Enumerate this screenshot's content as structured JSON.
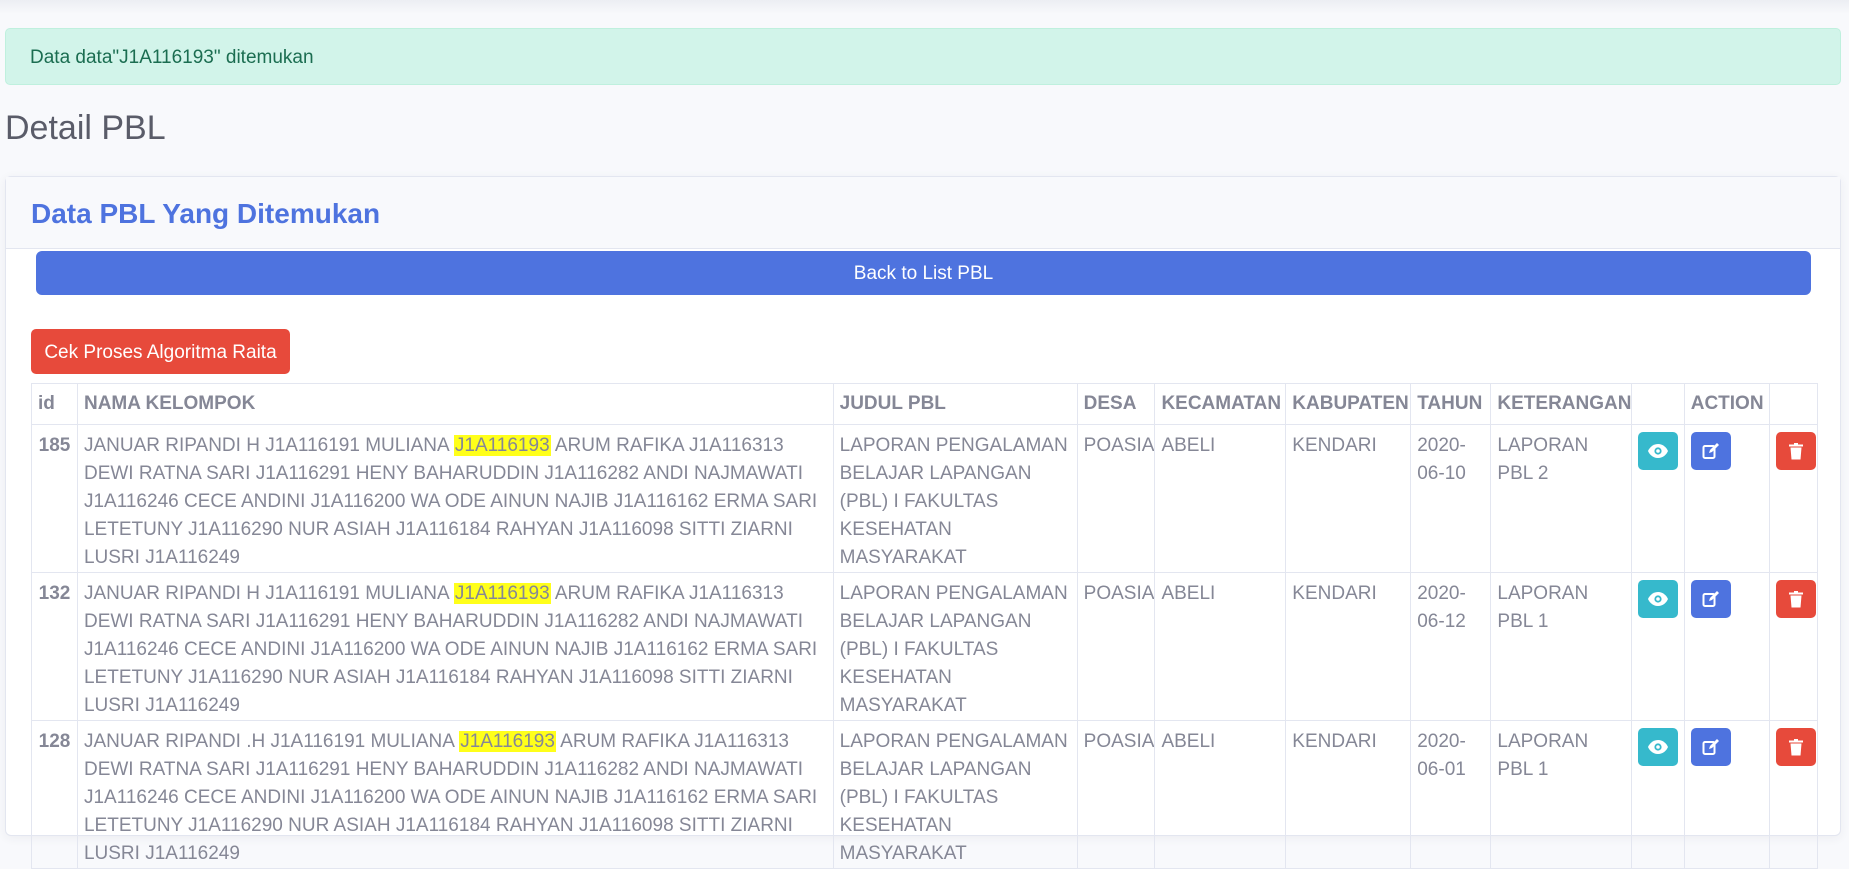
{
  "alert": {
    "message": "Data data\"J1A116193\" ditemukan"
  },
  "page": {
    "title": "Detail PBL"
  },
  "card": {
    "title": "Data PBL Yang Ditemukan",
    "back_label": "Back to List PBL",
    "cek_label": "Cek Proses Algoritma Raita"
  },
  "search": {
    "highlight": "J1A116193"
  },
  "table": {
    "headers": {
      "id": "id",
      "nama": "NAMA KELOMPOK",
      "judul": "JUDUL PBL",
      "desa": "DESA",
      "kecamatan": "KECAMATAN",
      "kabupaten": "KABUPATEN",
      "tahun": "TAHUN",
      "keterangan": "KETERANGAN",
      "blank": "",
      "action": "ACTION"
    },
    "rows": [
      {
        "id": "185",
        "nama_before": "JANUAR RIPANDI H J1A116191 MULIANA ",
        "nama_match": "J1A116193",
        "nama_after": " ARUM RAFIKA J1A116313 DEWI RATNA SARI J1A116291 HENY BAHARUDDIN J1A116282 ANDI NAJMAWATI J1A116246 CECE ANDINI J1A116200 WA ODE AINUN NAJIB J1A116162 ERMA SARI LETETUNY J1A116290 NUR ASIAH J1A116184 RAHYAN J1A116098 SITTI ZIARNI LUSRI J1A116249",
        "judul": "LAPORAN PENGALAMAN BELAJAR LAPANGAN (PBL) I FAKULTAS KESEHATAN MASYARAKAT",
        "desa": "POASIA",
        "kecamatan": "ABELI",
        "kabupaten": "KENDARI",
        "tahun": "2020-06-10",
        "keterangan": "LAPORAN PBL 2"
      },
      {
        "id": "132",
        "nama_before": "JANUAR RIPANDI H J1A116191 MULIANA ",
        "nama_match": "J1A116193",
        "nama_after": " ARUM RAFIKA J1A116313 DEWI RATNA SARI J1A116291 HENY BAHARUDDIN J1A116282 ANDI NAJMAWATI J1A116246 CECE ANDINI J1A116200 WA ODE AINUN NAJIB J1A116162 ERMA SARI LETETUNY J1A116290 NUR ASIAH J1A116184 RAHYAN J1A116098 SITTI ZIARNI LUSRI J1A116249",
        "judul": "LAPORAN PENGALAMAN BELAJAR LAPANGAN (PBL) I FAKULTAS KESEHATAN MASYARAKAT",
        "desa": "POASIA",
        "kecamatan": "ABELI",
        "kabupaten": "KENDARI",
        "tahun": "2020-06-12",
        "keterangan": "LAPORAN PBL 1"
      },
      {
        "id": "128",
        "nama_before": "JANUAR RIPANDI .H J1A116191 MULIANA ",
        "nama_match": "J1A116193",
        "nama_after": " ARUM RAFIKA J1A116313 DEWI RATNA SARI J1A116291 HENY BAHARUDDIN J1A116282 ANDI NAJMAWATI J1A116246 CECE ANDINI J1A116200 WA ODE AINUN NAJIB J1A116162 ERMA SARI LETETUNY J1A116290 NUR ASIAH J1A116184 RAHYAN J1A116098 SITTI ZIARNI LUSRI J1A116249",
        "judul": "LAPORAN PENGALAMAN BELAJAR LAPANGAN (PBL) I FAKULTAS KESEHATAN MASYARAKAT",
        "desa": "POASIA",
        "kecamatan": "ABELI",
        "kabupaten": "KENDARI",
        "tahun": "2020-06-01",
        "keterangan": "LAPORAN PBL 1"
      }
    ]
  },
  "icons": {
    "view": "eye-icon",
    "edit": "edit-icon",
    "delete": "trash-icon"
  },
  "colors": {
    "primary": "#4e73df",
    "danger": "#e74a3b",
    "info": "#36b9cc",
    "success_bg": "#d2f4ea",
    "highlight": "#ffff1a"
  }
}
